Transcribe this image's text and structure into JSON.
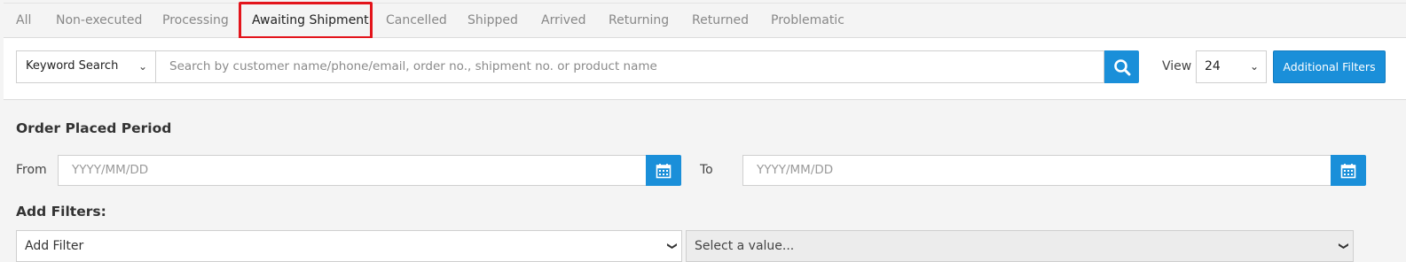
{
  "tabs": [
    {
      "label": "All",
      "active": false
    },
    {
      "label": "Non-executed",
      "active": false
    },
    {
      "label": "Processing",
      "active": false
    },
    {
      "label": "Awaiting Shipment",
      "active": true
    },
    {
      "label": "Cancelled",
      "active": false
    },
    {
      "label": "Shipped",
      "active": false
    },
    {
      "label": "Arrived",
      "active": false
    },
    {
      "label": "Returning",
      "active": false
    },
    {
      "label": "Returned",
      "active": false
    },
    {
      "label": "Problematic",
      "active": false
    }
  ],
  "search": {
    "type_label": "Keyword Search",
    "placeholder": "Search by customer name/phone/email, order no., shipment no. or product name",
    "view_label": "View",
    "view_value": "24",
    "additional_filters_label": "Additional Filters"
  },
  "filters": {
    "period_title": "Order Placed Period",
    "from_label": "From",
    "from_placeholder": "YYYY/MM/DD",
    "to_label": "To",
    "to_placeholder": "YYYY/MM/DD",
    "add_filters_title": "Add Filters:",
    "add_filter_value": "Add Filter",
    "select_value_placeholder": "Select a value..."
  },
  "colors": {
    "accent": "#1a8fd9",
    "highlight": "#e3141b"
  }
}
